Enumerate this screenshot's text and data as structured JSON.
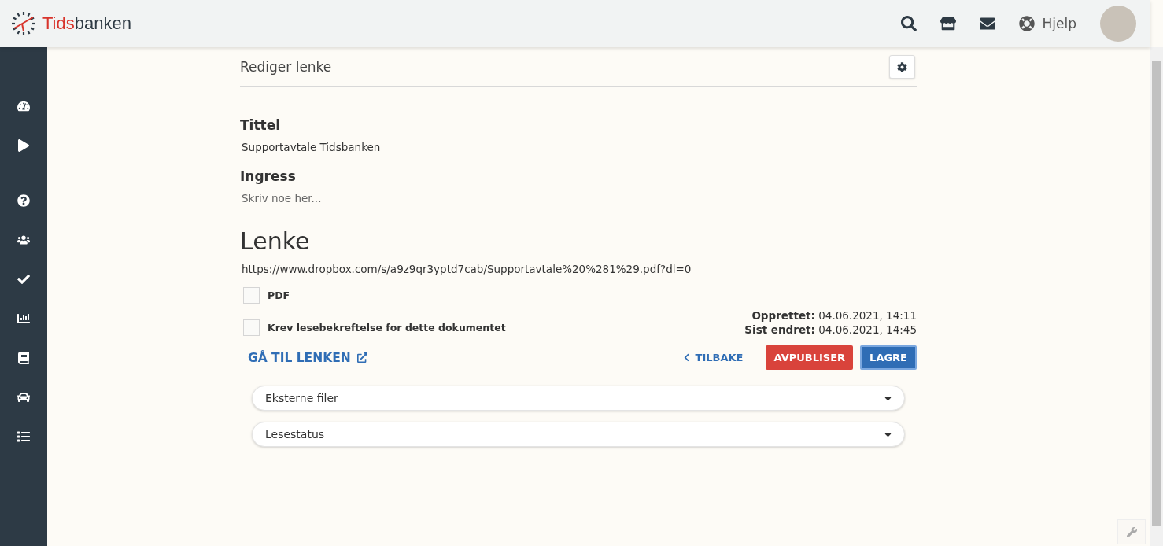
{
  "header": {
    "logo": {
      "accent": "Tids",
      "rest": "banken"
    },
    "help": "Hjelp"
  },
  "panel": {
    "title": "Rediger lenke"
  },
  "fields": [
    {
      "label": "Tittel",
      "value": "Supportavtale Tidsbanken"
    },
    {
      "label": "Ingress",
      "placeholder": "Skriv noe her..."
    }
  ],
  "link": {
    "heading": "Lenke",
    "value": "https://www.dropbox.com/s/a9z9qr3yptd7cab/Supportavtale%20%281%29.pdf?dl=0"
  },
  "checkboxes": [
    {
      "label": "PDF",
      "checked": false
    },
    {
      "label": "Krev lesebekreftelse for dette dokumentet",
      "checked": false
    }
  ],
  "meta": [
    "**Opprettet:** 04.06.2021, 14:11",
    "**Sist endret:** 04.06.2021, 14:45"
  ],
  "actions": {
    "open_link": "GÅ TIL LENKEN",
    "back": "TILBAKE",
    "buttons": [
      {
        "label": "AVPUBLISER",
        "kind": "danger"
      },
      {
        "label": "LAGRE",
        "kind": "primary"
      }
    ]
  },
  "sections": [
    {
      "label": "Eksterne filer",
      "expanded": false
    },
    {
      "label": "Lesestatus",
      "expanded": false
    }
  ]
}
